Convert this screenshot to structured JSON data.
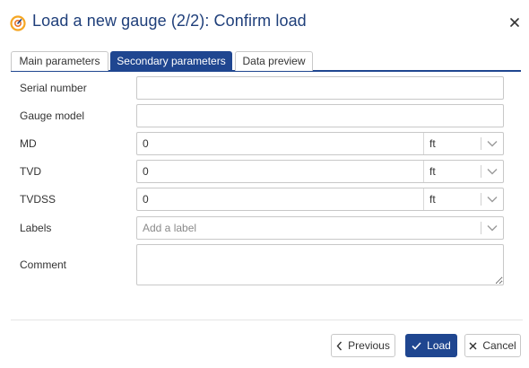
{
  "dialog": {
    "title": "Load a new gauge (2/2): Confirm load",
    "logo_icon": "gauge-logo-icon",
    "close_icon": "close-icon"
  },
  "tabs": [
    {
      "label": "Main parameters",
      "active": false
    },
    {
      "label": "Secondary parameters",
      "active": true
    },
    {
      "label": "Data preview",
      "active": false
    }
  ],
  "form": {
    "serial_number": {
      "label": "Serial number",
      "value": ""
    },
    "gauge_model": {
      "label": "Gauge model",
      "value": ""
    },
    "md": {
      "label": "MD",
      "value": "0",
      "unit": "ft"
    },
    "tvd": {
      "label": "TVD",
      "value": "0",
      "unit": "ft"
    },
    "tvdss": {
      "label": "TVDSS",
      "value": "0",
      "unit": "ft"
    },
    "labels": {
      "label": "Labels",
      "placeholder": "Add a label"
    },
    "comment": {
      "label": "Comment",
      "value": ""
    }
  },
  "buttons": {
    "previous": "Previous",
    "load": "Load",
    "cancel": "Cancel"
  },
  "colors": {
    "primary": "#1f4690",
    "title": "#1f3f7a",
    "logo_orange": "#f5a623"
  }
}
